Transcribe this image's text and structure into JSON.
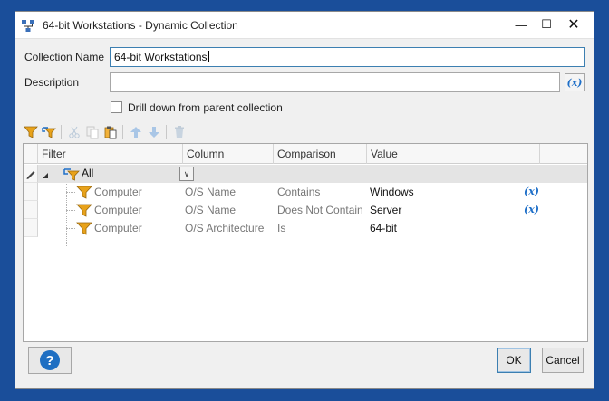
{
  "window": {
    "title": "64-bit Workstations - Dynamic Collection",
    "app_icon": "collection-network-icon",
    "min_glyph": "—",
    "max_glyph": "☐",
    "close_glyph": "✕"
  },
  "form": {
    "collection_name_label": "Collection Name",
    "collection_name_value": "64-bit Workstations",
    "description_label": "Description",
    "description_value": "",
    "variable_button_label": "(x)",
    "drill_down_label": "Drill down from parent collection",
    "drill_down_checked": false
  },
  "toolbar": {
    "icons": [
      "add-filter-icon",
      "add-filter-group-icon",
      "cut-icon",
      "copy-icon",
      "paste-icon",
      "move-up-icon",
      "move-down-icon",
      "delete-icon"
    ]
  },
  "grid": {
    "columns": [
      "Filter",
      "Column",
      "Comparison",
      "Value"
    ],
    "root": {
      "label": "All",
      "dropdown_glyph": "∨"
    },
    "rows": [
      {
        "filter": "Computer",
        "column": "O/S Name",
        "comparison": "Contains",
        "value": "Windows",
        "variable": "(x)"
      },
      {
        "filter": "Computer",
        "column": "O/S Name",
        "comparison": "Does Not Contain",
        "value": "Server",
        "variable": "(x)"
      },
      {
        "filter": "Computer",
        "column": "O/S Architecture",
        "comparison": "Is",
        "value": "64-bit",
        "variable": ""
      }
    ]
  },
  "footer": {
    "help_label": "?",
    "ok_label": "OK",
    "cancel_label": "Cancel"
  },
  "colors": {
    "background": "#1a4e9a",
    "accent": "#1e6fc8",
    "filter_icon": "#e8a21a"
  }
}
